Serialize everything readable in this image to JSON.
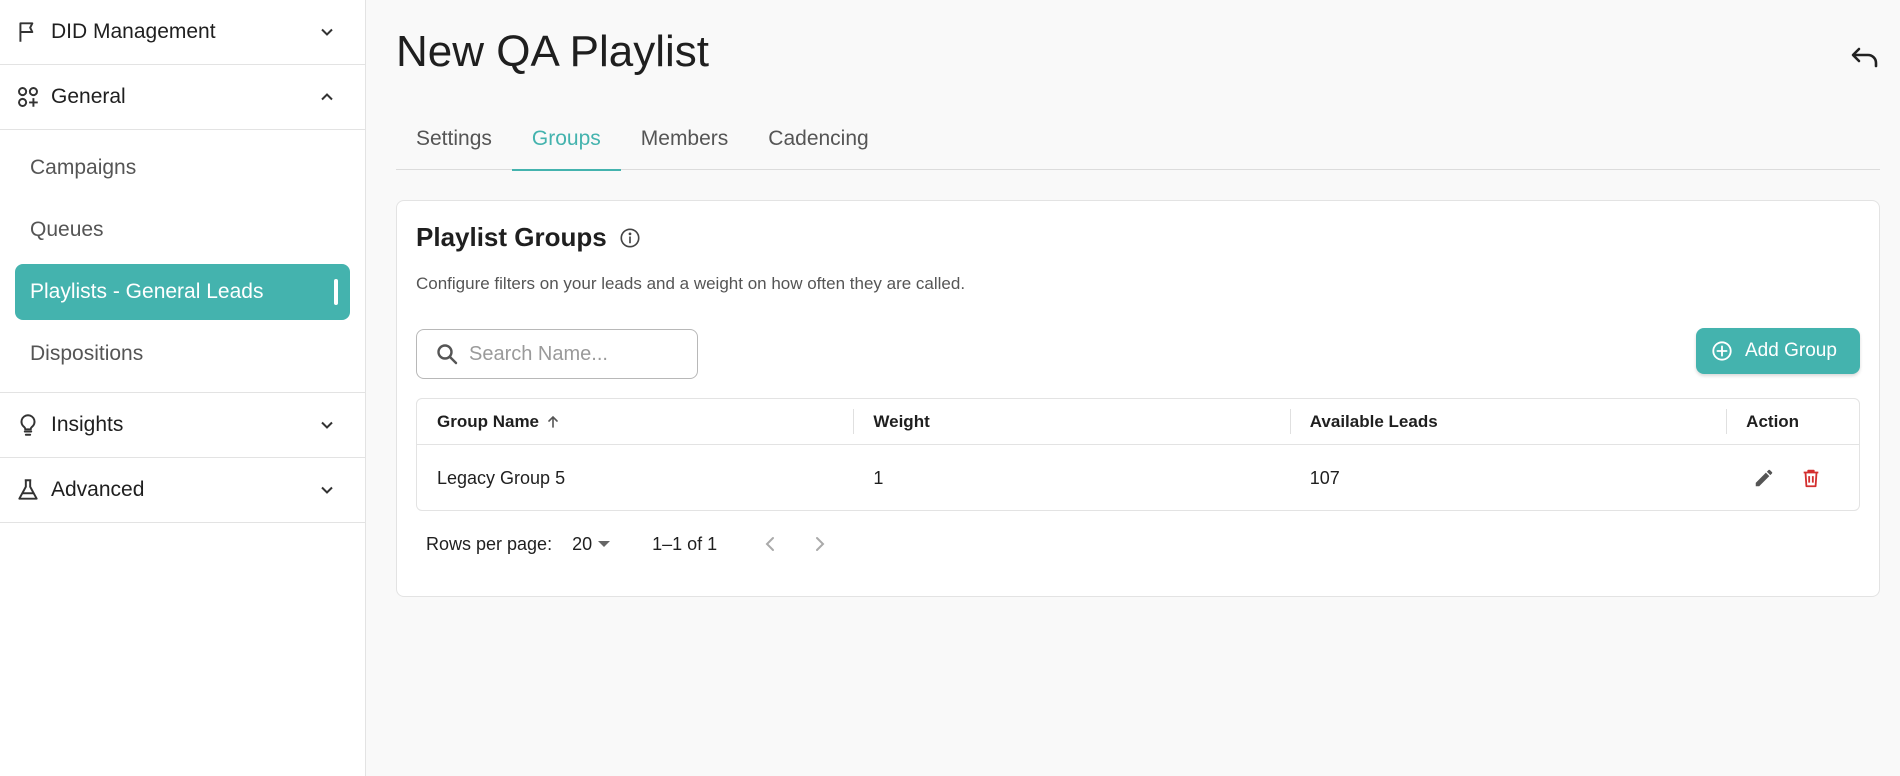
{
  "sidebar": {
    "sections": [
      {
        "label": "DID Management",
        "icon": "flag-icon",
        "expanded": false
      },
      {
        "label": "General",
        "icon": "shapes-icon",
        "expanded": true
      },
      {
        "label": "Insights",
        "icon": "lightbulb-icon",
        "expanded": false
      },
      {
        "label": "Advanced",
        "icon": "flask-icon",
        "expanded": false
      }
    ],
    "general_items": [
      {
        "label": "Campaigns"
      },
      {
        "label": "Queues"
      },
      {
        "label": "Playlists - General Leads",
        "active": true
      },
      {
        "label": "Dispositions"
      }
    ]
  },
  "page": {
    "title": "New QA Playlist",
    "undo_icon": "undo-icon"
  },
  "tabs": [
    {
      "label": "Settings"
    },
    {
      "label": "Groups",
      "active": true
    },
    {
      "label": "Members"
    },
    {
      "label": "Cadencing"
    }
  ],
  "card": {
    "title": "Playlist Groups",
    "description": "Configure filters on your leads and a weight on how often they are called.",
    "search_placeholder": "Search Name...",
    "add_button": "Add Group"
  },
  "table": {
    "columns": [
      "Group Name",
      "Weight",
      "Available Leads",
      "Action"
    ],
    "sort": {
      "column": "Group Name",
      "direction": "ascending"
    },
    "rows": [
      {
        "name": "Legacy Group 5",
        "weight": "1",
        "available_leads": "107"
      }
    ]
  },
  "pagination": {
    "rows_per_page_label": "Rows per page:",
    "rows_per_page": "20",
    "range": "1–1 of 1"
  },
  "colors": {
    "accent": "#44b3ae",
    "delete": "#d32f2f"
  }
}
